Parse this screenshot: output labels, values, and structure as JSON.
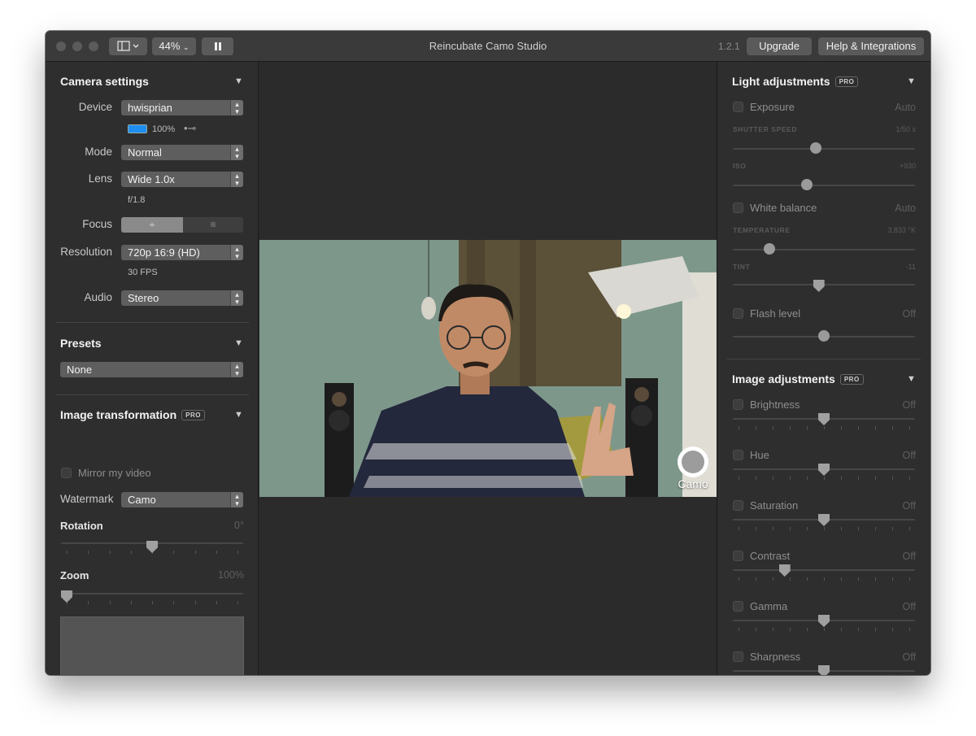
{
  "window": {
    "title": "Reincubate Camo Studio",
    "zoom": "44%",
    "version": "1.2.1",
    "upgrade_label": "Upgrade",
    "help_label": "Help & Integrations"
  },
  "camera_settings": {
    "title": "Camera settings",
    "device_label": "Device",
    "device_value": "hwisprian",
    "battery": "100%",
    "battery_level": 1.0,
    "mode_label": "Mode",
    "mode_value": "Normal",
    "lens_label": "Lens",
    "lens_value": "Wide 1.0x",
    "aperture": "f/1.8",
    "focus_label": "Focus",
    "resolution_label": "Resolution",
    "resolution_value": "720p 16:9 (HD)",
    "fps": "30 FPS",
    "audio_label": "Audio",
    "audio_value": "Stereo"
  },
  "presets": {
    "title": "Presets",
    "value": "None"
  },
  "image_transformation": {
    "title": "Image transformation",
    "pro": "PRO",
    "mirror_label": "Mirror my video",
    "watermark_label": "Watermark",
    "watermark_value": "Camo",
    "rotation_label": "Rotation",
    "rotation_value": "0°",
    "rotation_level": 0.5,
    "zoom_label": "Zoom",
    "zoom_value": "100%",
    "zoom_level": 0.0
  },
  "preview": {
    "watermark_text": "Camo"
  },
  "light_adjustments": {
    "title": "Light adjustments",
    "pro": "PRO",
    "exposure_label": "Exposure",
    "exposure_value": "Auto",
    "shutter_label": "SHUTTER SPEED",
    "shutter_value": "1/50 s",
    "shutter_level": 0.45,
    "iso_label": "ISO",
    "iso_value": "+930",
    "iso_level": 0.4,
    "wb_label": "White balance",
    "wb_value": "Auto",
    "temp_label": "TEMPERATURE",
    "temp_value": "3,833 °K",
    "temp_level": 0.18,
    "tint_label": "TINT",
    "tint_value": "-11",
    "tint_level": 0.47,
    "flash_label": "Flash level",
    "flash_value": "Off",
    "flash_level": 0.5
  },
  "image_adjustments": {
    "title": "Image adjustments",
    "pro": "PRO",
    "items": [
      {
        "label": "Brightness",
        "value": "Off",
        "level": 0.5
      },
      {
        "label": "Hue",
        "value": "Off",
        "level": 0.5
      },
      {
        "label": "Saturation",
        "value": "Off",
        "level": 0.5
      },
      {
        "label": "Contrast",
        "value": "Off",
        "level": 0.27
      },
      {
        "label": "Gamma",
        "value": "Off",
        "level": 0.5
      },
      {
        "label": "Sharpness",
        "value": "Off",
        "level": 0.5
      }
    ]
  }
}
